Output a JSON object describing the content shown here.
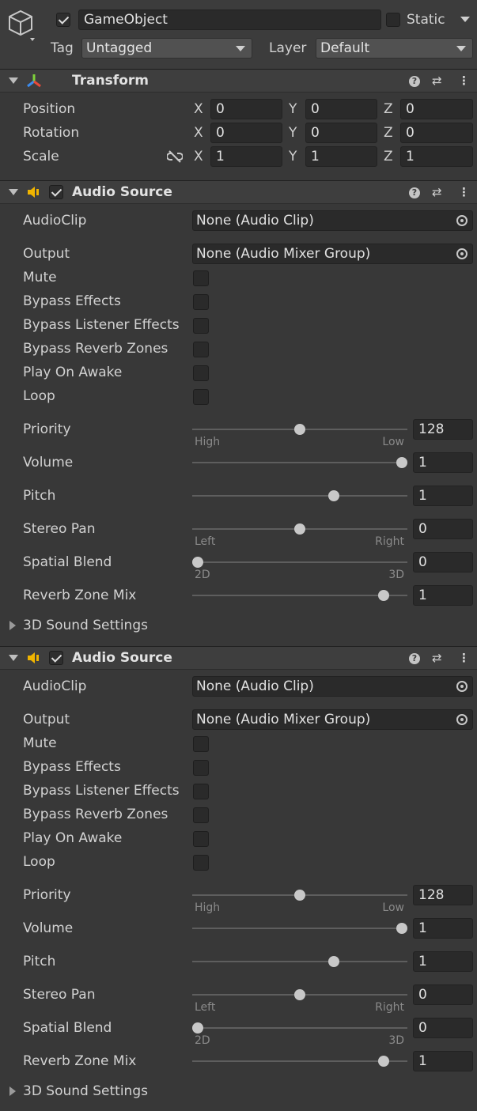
{
  "object": {
    "name": "GameObject",
    "static_label": "Static",
    "tag_label": "Tag",
    "tag_value": "Untagged",
    "layer_label": "Layer",
    "layer_value": "Default"
  },
  "transform": {
    "title": "Transform",
    "rows": [
      {
        "label": "Position",
        "x": "0",
        "y": "0",
        "z": "0"
      },
      {
        "label": "Rotation",
        "x": "0",
        "y": "0",
        "z": "0"
      },
      {
        "label": "Scale",
        "x": "1",
        "y": "1",
        "z": "1"
      }
    ],
    "axes": [
      "X",
      "Y",
      "Z"
    ]
  },
  "audio_sources": [
    {
      "title": "Audio Source",
      "audioclip_label": "AudioClip",
      "audioclip_value": "None (Audio Clip)",
      "output_label": "Output",
      "output_value": "None (Audio Mixer Group)",
      "toggles": [
        "Mute",
        "Bypass Effects",
        "Bypass Listener Effects",
        "Bypass Reverb Zones",
        "Play On Awake",
        "Loop"
      ],
      "priority": {
        "label": "Priority",
        "value": "128",
        "min_label": "High",
        "max_label": "Low",
        "level": 0.5
      },
      "volume": {
        "label": "Volume",
        "value": "1",
        "level": 1.0
      },
      "pitch": {
        "label": "Pitch",
        "value": "1",
        "level": 0.6667
      },
      "stereo_pan": {
        "label": "Stereo Pan",
        "value": "0",
        "min_label": "Left",
        "max_label": "Right",
        "level": 0.5
      },
      "spatial_blend": {
        "label": "Spatial Blend",
        "value": "0",
        "min_label": "2D",
        "max_label": "3D",
        "level": 0.0
      },
      "reverb_zone_mix": {
        "label": "Reverb Zone Mix",
        "value": "1",
        "level": 0.9091
      },
      "sound_settings_label": "3D Sound Settings"
    },
    {
      "title": "Audio Source",
      "audioclip_label": "AudioClip",
      "audioclip_value": "None (Audio Clip)",
      "output_label": "Output",
      "output_value": "None (Audio Mixer Group)",
      "toggles": [
        "Mute",
        "Bypass Effects",
        "Bypass Listener Effects",
        "Bypass Reverb Zones",
        "Play On Awake",
        "Loop"
      ],
      "priority": {
        "label": "Priority",
        "value": "128",
        "min_label": "High",
        "max_label": "Low",
        "level": 0.5
      },
      "volume": {
        "label": "Volume",
        "value": "1",
        "level": 1.0
      },
      "pitch": {
        "label": "Pitch",
        "value": "1",
        "level": 0.6667
      },
      "stereo_pan": {
        "label": "Stereo Pan",
        "value": "0",
        "min_label": "Left",
        "max_label": "Right",
        "level": 0.5
      },
      "spatial_blend": {
        "label": "Spatial Blend",
        "value": "0",
        "min_label": "2D",
        "max_label": "3D",
        "level": 0.0
      },
      "reverb_zone_mix": {
        "label": "Reverb Zone Mix",
        "value": "1",
        "level": 0.9091
      },
      "sound_settings_label": "3D Sound Settings"
    }
  ],
  "colors": {
    "background": "#383838",
    "header": "#3e3e3e",
    "field": "#2a2a2a",
    "speaker_icon": "#f0b400"
  },
  "icons": [
    "gameobject-cube-icon",
    "transform-axes-icon",
    "speaker-icon",
    "help-icon",
    "presets-icon",
    "kebab-menu-icon",
    "constrain-proportions-icon",
    "object-picker-icon"
  ]
}
